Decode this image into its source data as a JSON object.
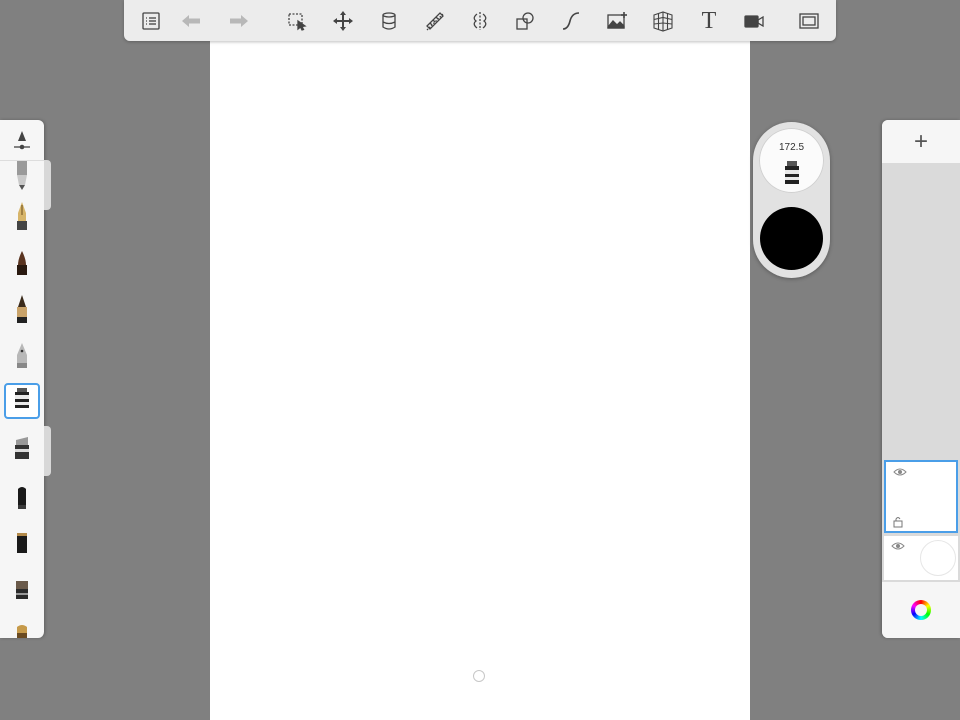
{
  "puck": {
    "brush_size": "172.5",
    "color": "#000000"
  },
  "colors": {
    "accent": "#4a9ee8",
    "background": "#808080",
    "canvas": "#ffffff"
  },
  "toolbar": {
    "items": [
      {
        "name": "menu-list-icon",
        "enabled": true
      },
      {
        "name": "undo-icon",
        "enabled": false
      },
      {
        "name": "redo-icon",
        "enabled": false
      },
      {
        "name": "selection-icon",
        "enabled": true
      },
      {
        "name": "transform-icon",
        "enabled": true
      },
      {
        "name": "fill-bucket-icon",
        "enabled": true
      },
      {
        "name": "ruler-icon",
        "enabled": true
      },
      {
        "name": "symmetry-icon",
        "enabled": true
      },
      {
        "name": "shapes-icon",
        "enabled": true
      },
      {
        "name": "curve-icon",
        "enabled": true
      },
      {
        "name": "add-image-icon",
        "enabled": true
      },
      {
        "name": "perspective-grid-icon",
        "enabled": true
      },
      {
        "name": "text-icon",
        "enabled": true
      },
      {
        "name": "time-lapse-icon",
        "enabled": true
      },
      {
        "name": "fullscreen-icon",
        "enabled": true
      }
    ],
    "text_tool_label": "T"
  },
  "brushes": {
    "items": [
      "pencil",
      "ballpoint-pen",
      "brush-pen",
      "ink-pen",
      "airbrush",
      "marker",
      "chisel-marker",
      "felt-pen",
      "block-marker",
      "chisel-pen",
      "flat-brush"
    ],
    "selected": "marker"
  },
  "layers": {
    "add_label": "+",
    "items": [
      {
        "name": "layer-1",
        "visible": true,
        "selected": true
      },
      {
        "name": "background-layer",
        "visible": true,
        "selected": false
      }
    ]
  }
}
